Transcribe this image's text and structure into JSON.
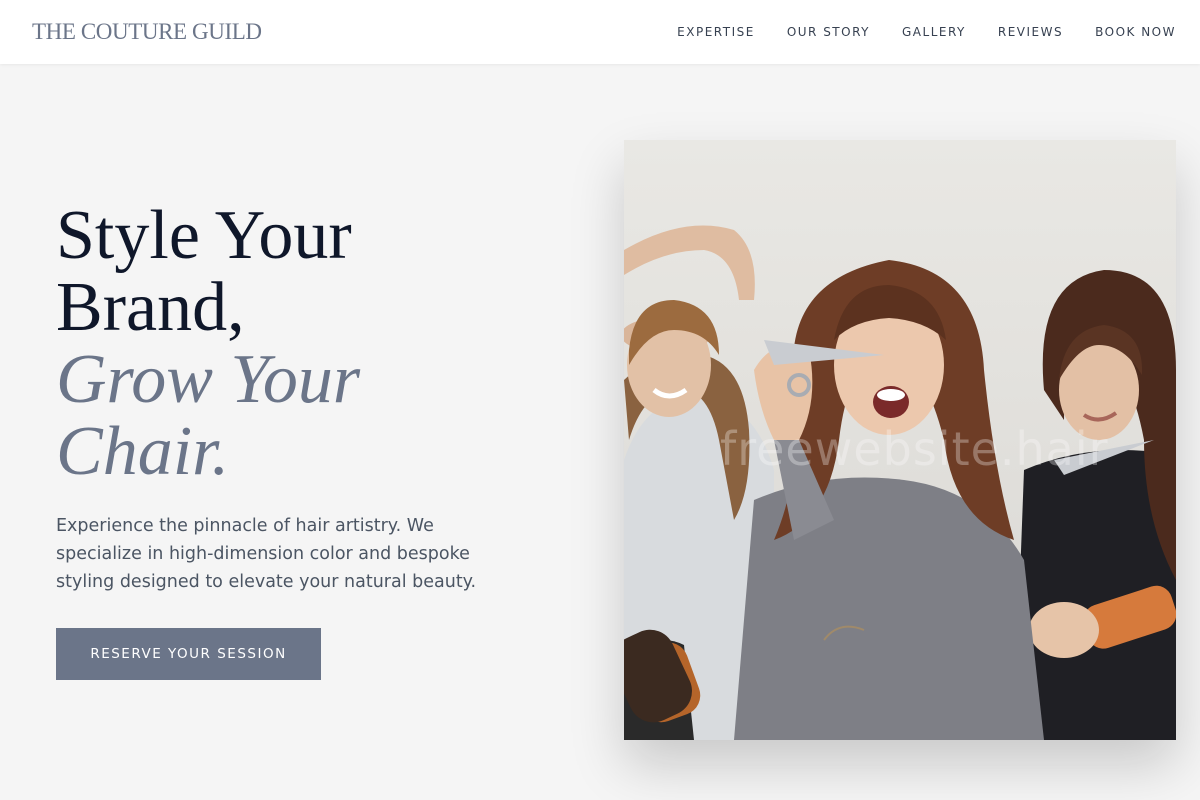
{
  "header": {
    "brand": "THE COUTURE GUILD",
    "nav": [
      {
        "label": "EXPERTISE"
      },
      {
        "label": "OUR STORY"
      },
      {
        "label": "GALLERY"
      },
      {
        "label": "REVIEWS"
      },
      {
        "label": "BOOK NOW"
      }
    ]
  },
  "hero": {
    "title_line1": "Style Your",
    "title_line2": "Brand,",
    "title_line3": "Grow Your",
    "title_line4": "Chair.",
    "description": "Experience the pinnacle of hair artistry. We specialize in high-dimension color and bespoke styling designed to elevate your natural beauty.",
    "cta_label": "RESERVE YOUR SESSION"
  },
  "image": {
    "watermark": "freewebsite.hair"
  },
  "colors": {
    "accent": "#6b7589",
    "headline": "#0f172a",
    "background": "#f5f5f5"
  }
}
